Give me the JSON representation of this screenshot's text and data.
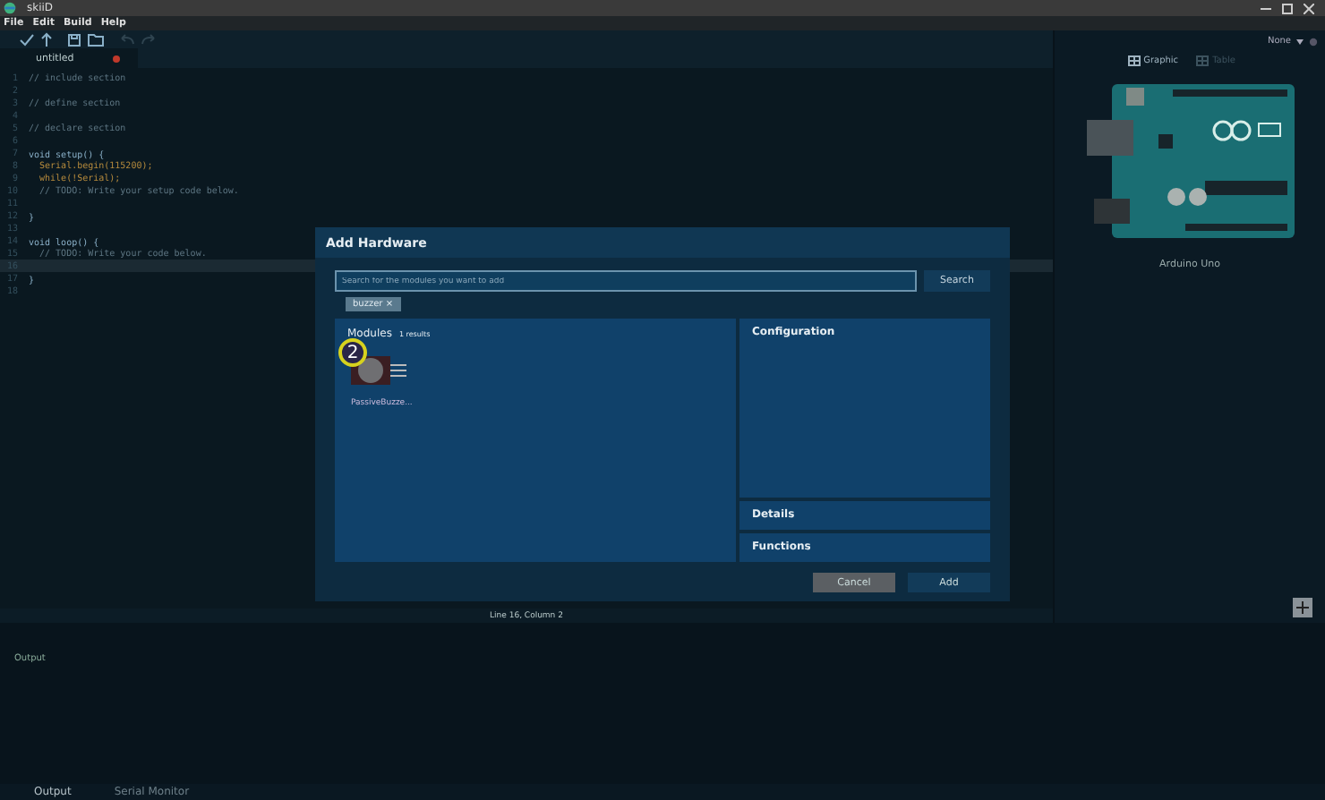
{
  "window": {
    "title": "skiiD"
  },
  "menu": [
    "File",
    "Edit",
    "Build",
    "Help"
  ],
  "toolbar": [
    {
      "kind": "verify",
      "disabled": false
    },
    {
      "kind": "upload",
      "disabled": false
    },
    {
      "kind": "save",
      "disabled": false
    },
    {
      "kind": "open",
      "disabled": false
    },
    {
      "kind": "undo",
      "disabled": true
    },
    {
      "kind": "redo",
      "disabled": true
    }
  ],
  "editor_tab": {
    "label": "untitled",
    "modified": true
  },
  "code": [
    {
      "number": "1",
      "text": "// include section",
      "kind": "comment",
      "current": false
    },
    {
      "number": "2",
      "current": false
    },
    {
      "number": "3",
      "text": "// define section",
      "kind": "comment",
      "current": false
    },
    {
      "number": "4",
      "current": false
    },
    {
      "number": "5",
      "text": "// declare section",
      "kind": "comment",
      "current": false
    },
    {
      "number": "6",
      "current": false
    },
    {
      "number": "7",
      "text": "void setup() {",
      "kind": "code",
      "current": false
    },
    {
      "number": "8",
      "text": "  Serial.begin(115200);",
      "kind": "call",
      "current": false
    },
    {
      "number": "9",
      "text": "  while(!Serial);",
      "kind": "call",
      "current": false
    },
    {
      "number": "10",
      "text": "  // TODO: Write your setup code below.",
      "kind": "comment",
      "current": false
    },
    {
      "number": "11",
      "current": false
    },
    {
      "number": "12",
      "text": "}",
      "kind": "code",
      "current": false
    },
    {
      "number": "13",
      "current": false
    },
    {
      "number": "14",
      "text": "void loop() {",
      "kind": "code",
      "current": false
    },
    {
      "number": "15",
      "text": "  // TODO: Write your code below.",
      "kind": "comment",
      "current": false
    },
    {
      "number": "16",
      "current": true
    },
    {
      "number": "17",
      "text": "}",
      "kind": "code",
      "current": false
    },
    {
      "number": "18",
      "current": false
    }
  ],
  "status_bar": "Line 16, Column 2",
  "right_panel": {
    "board_select": "None",
    "views": [
      {
        "label": "Graphic",
        "selected": true
      },
      {
        "label": "Table",
        "selected": false
      }
    ],
    "board_name": "Arduino Uno"
  },
  "output": {
    "label": "Output"
  },
  "bottom_tabs": [
    {
      "label": "Output",
      "selected": true
    },
    {
      "label": "Serial Monitor",
      "selected": false
    }
  ],
  "dialog": {
    "title": "Add Hardware",
    "search": {
      "placeholder": "Search for the modules you want to add"
    },
    "search_button": "Search",
    "filter_chip": {
      "label": "buzzer",
      "remove": "×"
    },
    "modules": {
      "title": "Modules",
      "count": "1 results",
      "items": [
        {
          "name": "PassiveBuzze...",
          "badge": "2"
        }
      ]
    },
    "sections": [
      "Configuration",
      "Details",
      "Functions"
    ],
    "buttons": [
      {
        "label": "Cancel",
        "kind": "secondary"
      },
      {
        "label": "Add",
        "kind": "primary"
      }
    ]
  }
}
